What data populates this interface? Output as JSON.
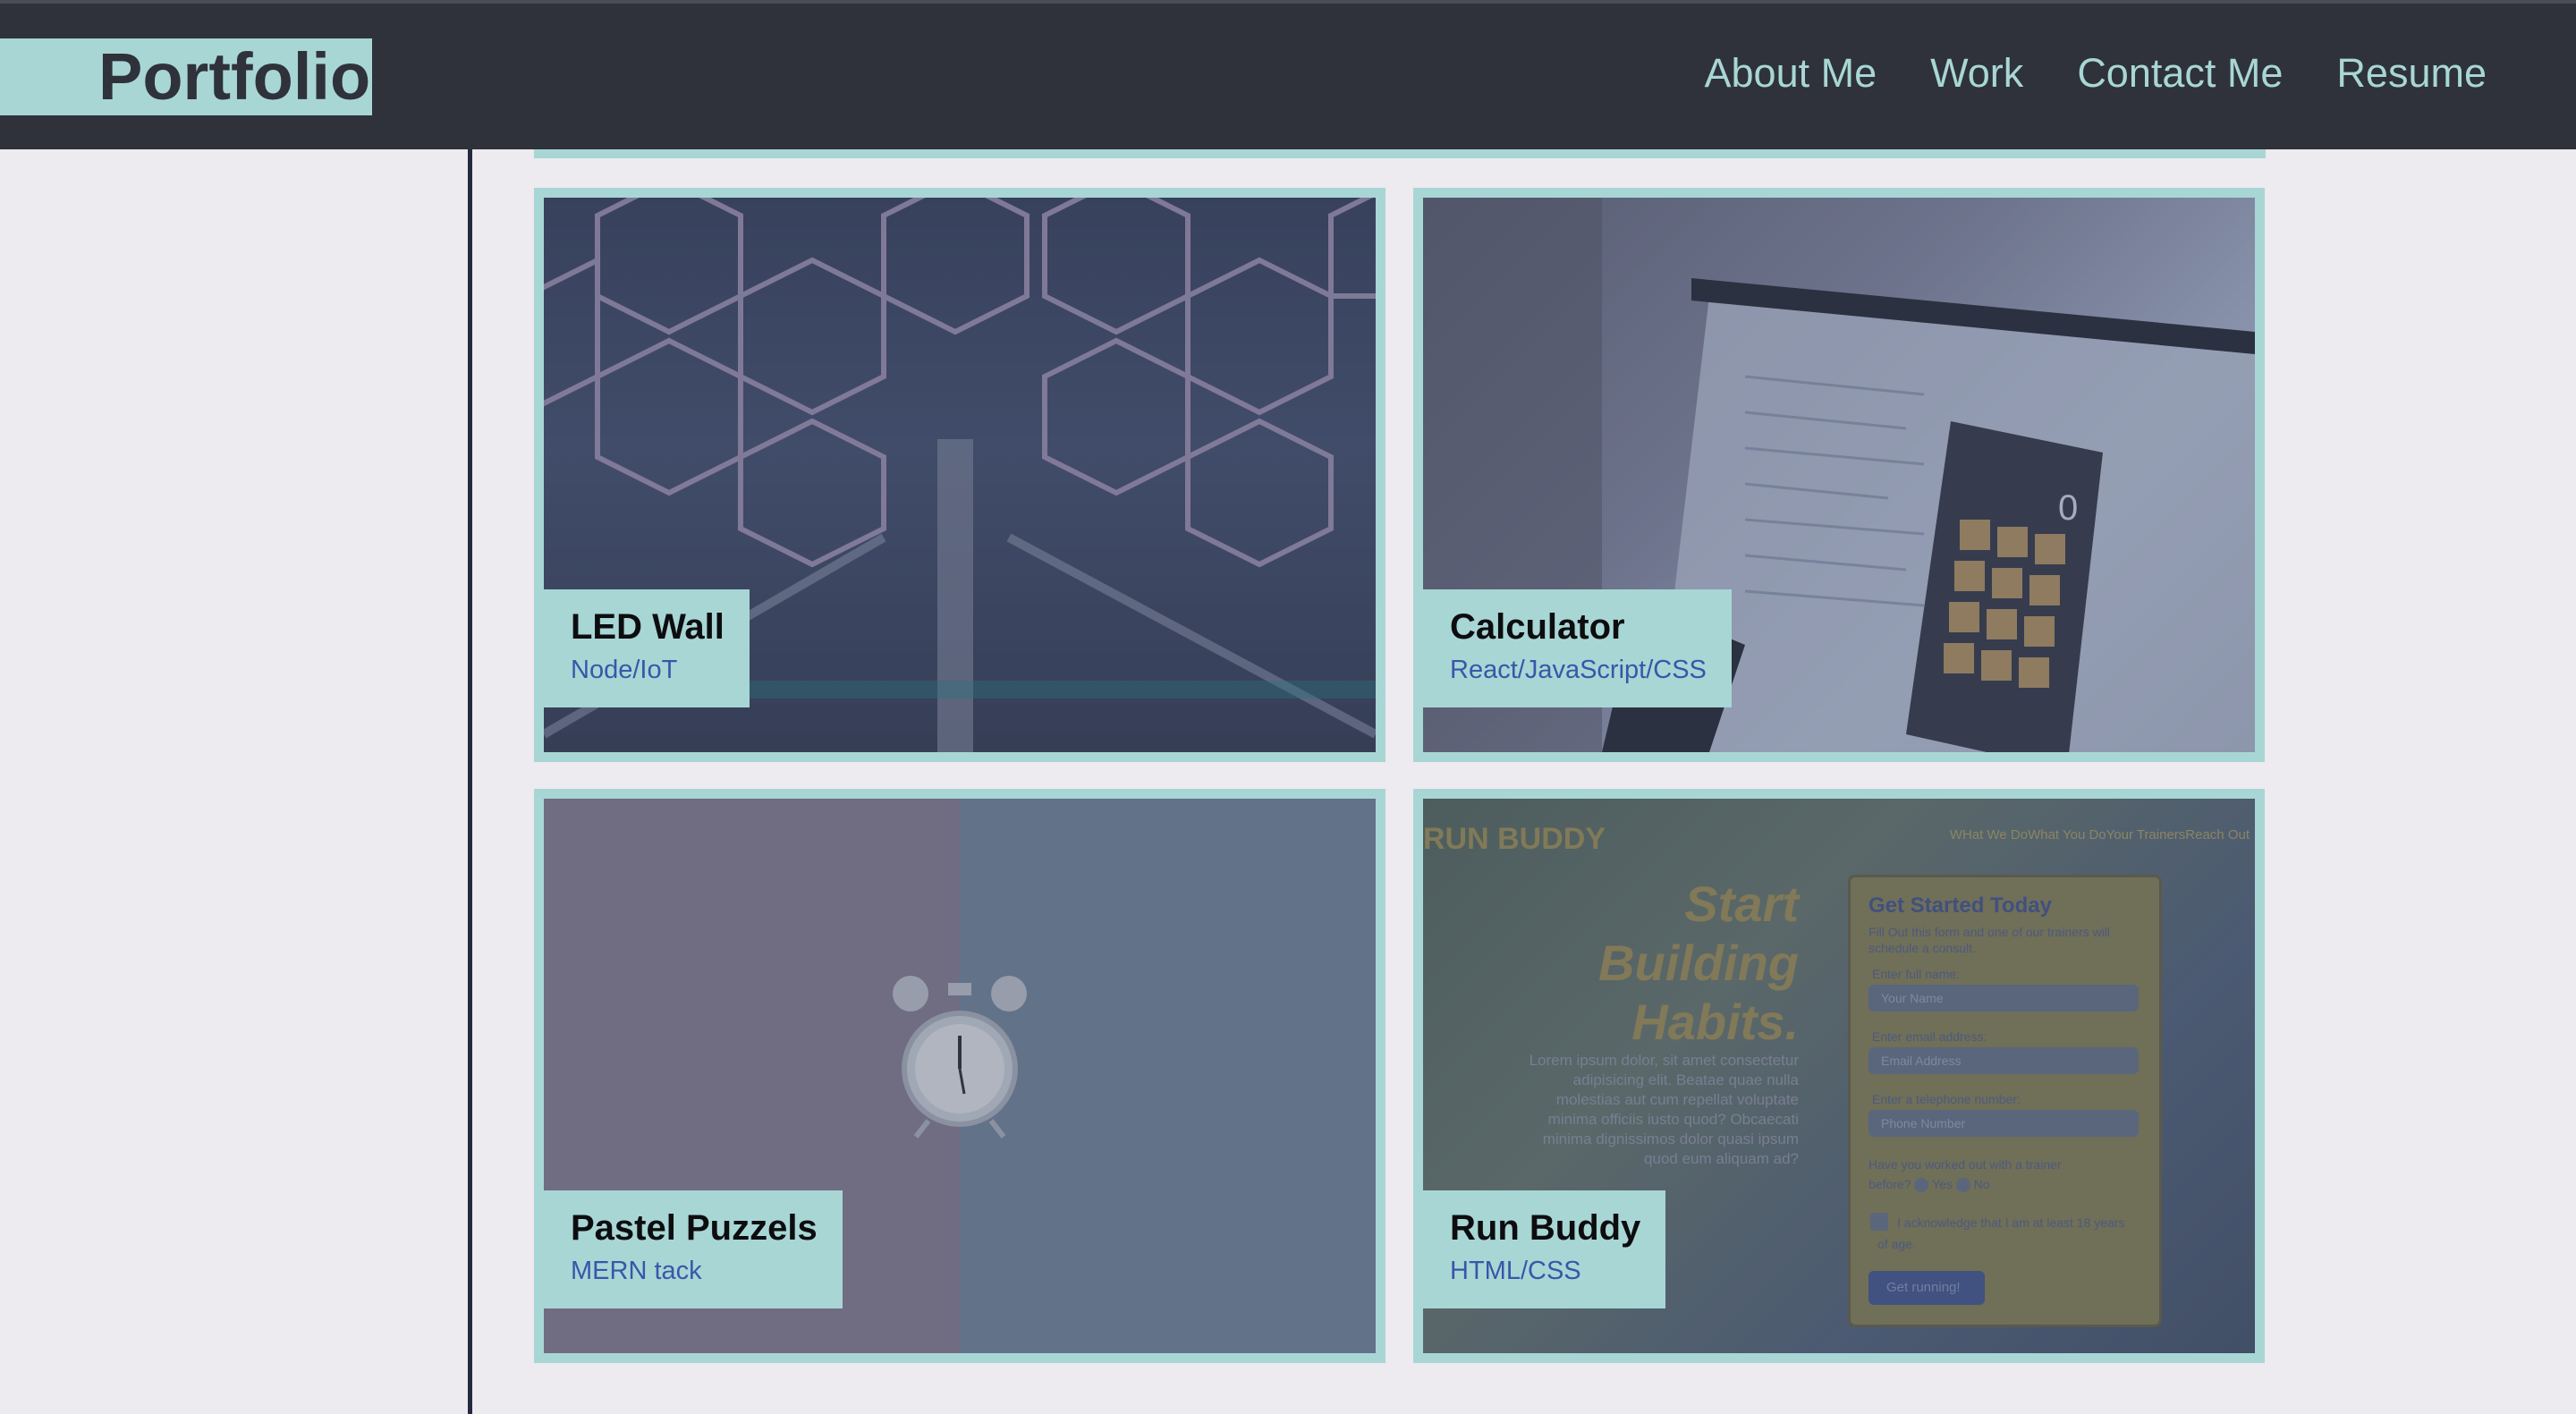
{
  "header": {
    "brand": "Portfolio",
    "nav": [
      "About Me",
      "Work",
      "Contact Me",
      "Resume"
    ]
  },
  "projects": [
    {
      "title": "LED Wall",
      "subtitle": "Node/IoT",
      "image": "hexagon-led-wall-photo"
    },
    {
      "title": "Calculator",
      "subtitle": "React/JavaScript/CSS",
      "image": "laptop-calculator-photo"
    },
    {
      "title": "Pastel Puzzels",
      "subtitle": "MERN tack",
      "image": "alarm-clock-pastel-photo"
    },
    {
      "title": "Run Buddy",
      "subtitle": "HTML/CSS",
      "image": "run-buddy-site-screenshot"
    }
  ],
  "run_buddy_preview": {
    "logo": "RUN BUDDY",
    "nav": "WHat We DoWhat You DoYour TrainersReach Out",
    "hero": [
      "Start",
      "Building",
      "Habits."
    ],
    "lorem": "Lorem ipsum dolor, sit amet consectetur adipisicing elit. Beatae quae nulla molestias aut cum repellat voluptate minima officiis iusto quod? Obcaecati minima dignissimos dolor quasi ipsum quod eum aliquam ad?",
    "form_title": "Get Started Today",
    "form_intro": "Fill Out this form and one of our trainers will schedule a consult.",
    "name_label": "Enter full name:",
    "name_placeholder": "Your Name",
    "email_label": "Enter email address:",
    "email_placeholder": "Email Address",
    "phone_label": "Enter a telephone number:",
    "phone_placeholder": "Phone Number",
    "question": "Have you worked out with a trainer before?",
    "yes": "Yes",
    "no": "No",
    "ack": "I acknowledge that I am at least 18 years of age.",
    "submit": "Get running!"
  },
  "calculator_display": "0",
  "colors": {
    "header_bg": "#2f323a",
    "accent": "#a8d6d5",
    "page_bg": "#edeaf0",
    "subtitle": "#3a56a8"
  }
}
